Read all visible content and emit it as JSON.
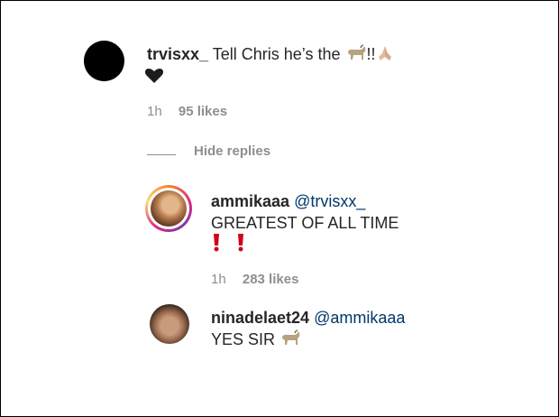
{
  "comments": [
    {
      "username": "trvisxx_",
      "text": "Tell Chris he’s the",
      "text_suffix": "!!",
      "time": "1h",
      "likes": "95 likes"
    },
    {
      "username": "ammikaaa",
      "mention": "@trvisxx_",
      "text": "GREATEST OF ALL TIME",
      "time": "1h",
      "likes": "283 likes"
    },
    {
      "username": "ninadelaet24",
      "mention": "@ammikaaa",
      "text": "YES SIR"
    }
  ],
  "replies_toggle": "Hide replies",
  "icons": [
    "goat-emoji",
    "folded-hands-emoji",
    "black-heart-emoji",
    "exclamation-emoji"
  ]
}
